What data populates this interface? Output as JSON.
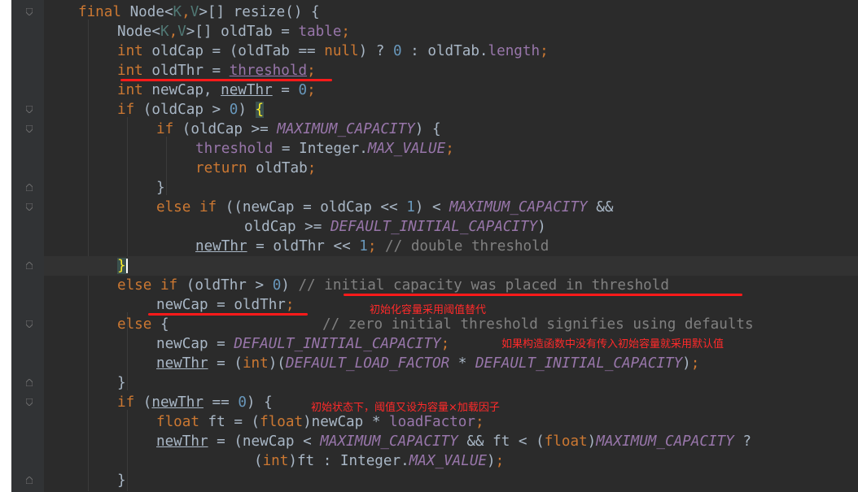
{
  "code": {
    "l1": {
      "kw": "final",
      "type": "Node",
      "lt": "<",
      "K": "K",
      "comma": ",",
      "V": "V",
      "gt": ">",
      "rest": "[] resize() {"
    },
    "l2": {
      "type": "Node",
      "lt": "<",
      "K": "K",
      "comma": ",",
      "V": "V",
      "gt": ">",
      "mid": "[] oldTab = ",
      "field": "table",
      "semi": ";"
    },
    "l3": {
      "kw": "int",
      "mid": " oldCap = (oldTab == ",
      "null": "null",
      "q": ") ? ",
      "zero": "0",
      "colon": " : oldTab.",
      "field": "length",
      "semi": ";"
    },
    "l4": {
      "kw": "int",
      "mid": " oldThr = ",
      "field": "threshold",
      "semi": ";"
    },
    "l5": {
      "kw": "int",
      "mid": " newCap, ",
      "var": "newThr",
      "eq": " = ",
      "zero": "0",
      "semi": ";"
    },
    "l6": {
      "kw": "if",
      "mid": " (oldCap > ",
      "zero": "0",
      "close": ") ",
      "brace": "{"
    },
    "l7": {
      "kw": "if",
      "mid": " (oldCap >= ",
      "const": "MAXIMUM_CAPACITY",
      "end": ") {"
    },
    "l8": {
      "field": "threshold",
      "mid": " = Integer.",
      "const": "MAX_VALUE",
      "semi": ";"
    },
    "l9": {
      "kw": "return",
      "rest": " oldTab",
      "semi": ";"
    },
    "l10": {
      "text": "}"
    },
    "l11": {
      "kw1": "else",
      "sp": " ",
      "kw2": "if",
      "mid": " ((newCap = oldCap << ",
      "one": "1",
      "lt": ") < ",
      "const": "MAXIMUM_CAPACITY",
      "and": " &&"
    },
    "l12": {
      "mid": "oldCap >= ",
      "const": "DEFAULT_INITIAL_CAPACITY",
      "end": ")"
    },
    "l13": {
      "var": "newThr",
      "mid": " = oldThr << ",
      "one": "1",
      "semi": ";",
      "comment": " // double threshold"
    },
    "l14": {
      "brace": "}"
    },
    "l15": {
      "kw1": "else",
      "sp": " ",
      "kw2": "if",
      "mid": " (oldThr > ",
      "zero": "0",
      "close": ") ",
      "comment": "// initial capacity was placed in threshold"
    },
    "l16": {
      "text": "newCap = oldThr",
      "semi": ";"
    },
    "l17": {
      "kw": "else",
      "mid": " {",
      "comment": "// zero initial threshold signifies using defaults"
    },
    "l18": {
      "mid": "newCap = ",
      "const": "DEFAULT_INITIAL_CAPACITY",
      "semi": ";"
    },
    "l19": {
      "var": "newThr",
      "mid": " = (",
      "kw": "int",
      "cl": ")(",
      "c1": "DEFAULT_LOAD_FACTOR",
      "mul": " * ",
      "c2": "DEFAULT_INITIAL_CAPACITY",
      "end": ")",
      "semi": ";"
    },
    "l20": {
      "text": "}"
    },
    "l21": {
      "kw": "if",
      "mid": " (",
      "var": "newThr",
      "rest": " == ",
      "zero": "0",
      "end": ") {"
    },
    "l22": {
      "kw": "float",
      "mid": " ft = (",
      "kw2": "float",
      "rest": ")newCap * ",
      "field": "loadFactor",
      "semi": ";"
    },
    "l23": {
      "var": "newThr",
      "mid": " = (newCap < ",
      "c1": "MAXIMUM_CAPACITY",
      "and": " && ft < (",
      "kw": "float",
      "cl": ")",
      "c2": "MAXIMUM_CAPACITY",
      "q": " ?"
    },
    "l24": {
      "p": "(",
      "kw": "int",
      "mid": ")ft : Integer.",
      "const": "MAX_VALUE",
      "end": ")",
      "semi": ";"
    },
    "l25": {
      "text": "}"
    }
  },
  "annotations": {
    "a1": "初始化容量采用阈值替代",
    "a2": "如果构造函数中没有传入初始容量就采用默认值",
    "a3": "初始状态下，阈值又设为容量×加载因子"
  },
  "colors": {
    "background": "#2b2b2b",
    "gutter": "#313335",
    "keyword": "#cc7832",
    "text": "#a9b7c6",
    "number": "#6897bb",
    "field": "#9876aa",
    "comment": "#808080",
    "annotation": "#ff2a2a"
  }
}
